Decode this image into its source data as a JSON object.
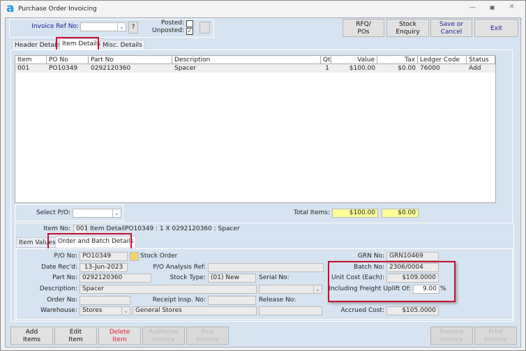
{
  "window": {
    "title": "Purchase Order Invoicing",
    "logo": "a"
  },
  "top": {
    "invoice_ref_label": "Invoice Ref No:",
    "invoice_ref_value": "",
    "help_label": "?",
    "posted_label": "Posted:",
    "posted_checked": false,
    "unposted_label": "Unposted:",
    "unposted_checked": true
  },
  "toolbar": {
    "rfq": "RFQ/\nPOs",
    "stock": "Stock\nEnquiry",
    "save": "Save or\nCancel",
    "exit": "Exit"
  },
  "tabs": [
    {
      "label": "Header Details"
    },
    {
      "label": "Item Details",
      "active": true
    },
    {
      "label": "Misc. Details"
    }
  ],
  "grid": {
    "columns": [
      "Item",
      "PO No",
      "Part No",
      "Description",
      "Qty",
      "Value",
      "Tax",
      "Ledger Code",
      "Status"
    ],
    "rows": [
      [
        "001",
        "PO10349",
        "0292120360",
        "Spacer",
        "1",
        "$100.00",
        "$0.00",
        "76000",
        "Add"
      ]
    ]
  },
  "select_po": {
    "label": "Select P/O:",
    "value": ""
  },
  "totals": {
    "label": "Total Items:",
    "value": "$100.00",
    "tax": "$0.00"
  },
  "item": {
    "no_label": "Item No:",
    "no": "001",
    "detail_label": "Item Detail:",
    "detail": "PO10349 : 1 X 0292120360 : Spacer"
  },
  "subtabs": [
    {
      "label": "Item Values"
    },
    {
      "label": "Order and Batch Details",
      "active": true
    }
  ],
  "form": {
    "po_no_label": "P/O No:",
    "po_no": "PO10349",
    "po_type": "Stock Order",
    "date_label": "Date Rec'd:",
    "date": "13-Jun-2023",
    "analysis_label": "P/O Analysis Ref:",
    "analysis": "",
    "part_label": "Part No:",
    "part": "0292120360",
    "stock_type_label": "Stock Type:",
    "stock_type": "(01) New",
    "serial_label": "Serial No:",
    "serial": "",
    "desc_label": "Description:",
    "desc": "Spacer",
    "order_label": "Order No:",
    "order": "",
    "receipt_label": "Receipt Insp. No:",
    "receipt": "",
    "release_label": "Release No:",
    "release": "",
    "warehouse_label": "Warehouse:",
    "warehouse": "Stores",
    "warehouse_name": "General Stores",
    "grn_label": "GRN No:",
    "grn": "GRN10469",
    "batch_label": "Batch No:",
    "batch": "2306/0004",
    "unit_cost_label": "Unit Cost (Each):",
    "unit_cost": "$109.0000",
    "freight_label": "Including Freight Uplift Of:",
    "freight": "9.00",
    "freight_unit": "%",
    "accrued_label": "Accrued Cost:",
    "accrued": "$105.0000"
  },
  "bottom": {
    "add": "Add\nItems",
    "edit": "Edit\nItem",
    "delete": "Delete\nItem",
    "authorise": "Authorise\nInvoice",
    "post": "Post\nInvoice",
    "preview": "Preview\nInvoice",
    "print": "Print\nInvoice"
  },
  "colors": {
    "highlight": "#c8102e",
    "total_bg": "#ffff99",
    "delete": "#e0203a",
    "link": "#1a1a9a"
  }
}
